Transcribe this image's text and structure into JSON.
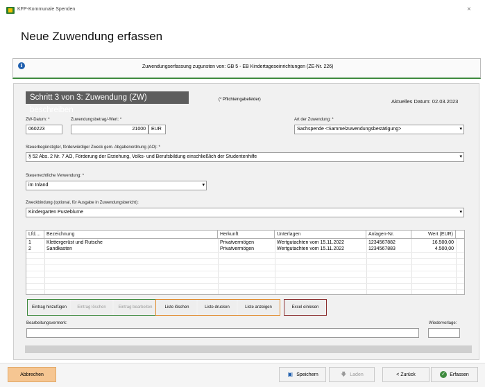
{
  "window": {
    "title": "KFP-Kommunale Spenden",
    "close": "×"
  },
  "page_title": "Neue Zuwendung erfassen",
  "info": {
    "icon": "info-icon",
    "text": "Zuwendungserfassung zugunsten von:  GB 5 - EB Kindertageseinrichtungen (ZE-Nr. 226)"
  },
  "step": {
    "heading": "Schritt 3 von 3:  Zuwendung (ZW) beschreiben",
    "required_note": "(* Pflichteingabefelder)",
    "date_label": "Aktuelles Datum: 02.03.2023"
  },
  "form": {
    "zw_datum": {
      "label": "ZW-Datum: *",
      "value": "060223"
    },
    "betrag": {
      "label": "Zuwendungsbetrag/-Wert: *",
      "value": "21000",
      "unit": "EUR"
    },
    "art": {
      "label": "Art der Zuwendung: *",
      "value": "Sachspende  <Sammelzuwendungsbestätigung>"
    },
    "zweck": {
      "label": "Steuerbegünstigter, förderwürdiger Zweck gem. Abgabenordnung (AO): *",
      "value": "§ 52 Abs. 2 Nr. 7 AO, Förderung der Erziehung, Volks- und Berufsbildung einschließlich der Studentenhilfe"
    },
    "verwendung": {
      "label": "Steuerrechtliche Verwendung: *",
      "value": "im Inland"
    },
    "zweckbindung": {
      "label": "Zweckbindung (optional, für Ausgabe in Zuwendungsbericht):",
      "value": "Kindergarten Pusteblume"
    }
  },
  "grid": {
    "columns": [
      "Lfd....",
      "Bezeichnung",
      "Herkunft",
      "Unterlagen",
      "Anlagen-Nr.",
      "Wert (EUR)"
    ],
    "rows": [
      [
        "1",
        "Klettergerüst und Rutsche",
        "Privatvermögen",
        "Wertgutachten vom 15.11.2022",
        "1234567882",
        "16.500,00"
      ],
      [
        "2",
        "Sandkasten",
        "Privatvermögen",
        "Wertgutachten vom 15.11.2022",
        "1234567883",
        "4.500,00"
      ]
    ]
  },
  "buttons": {
    "eintrag_hinzufuegen": "Eintrag hinzufügen",
    "eintrag_loeschen": "Eintrag löschen",
    "eintrag_bearbeiten": "Eintrag bearbeiten",
    "liste_loeschen": "Liste löschen",
    "liste_drucken": "Liste drucken",
    "liste_anzeigen": "Liste anzeigen",
    "excel_einlesen": "Excel einlesen"
  },
  "bearbeitungsvermerk": {
    "label": "Bearbeitungsvermerk:",
    "value": ""
  },
  "wiedervorlage": {
    "label": "Wiedervorlage:",
    "value": ""
  },
  "footer": {
    "abbrechen": "Abbrechen",
    "speichern": "Speichern",
    "laden": "Laden",
    "zurueck": "< Zurück",
    "erfassen": "Erfassen"
  },
  "colors": {
    "green_group": "#3e8a3e",
    "orange_group": "#e08a2c",
    "brown_group": "#8a2d2d",
    "cancel_bg": "#f6c692"
  }
}
